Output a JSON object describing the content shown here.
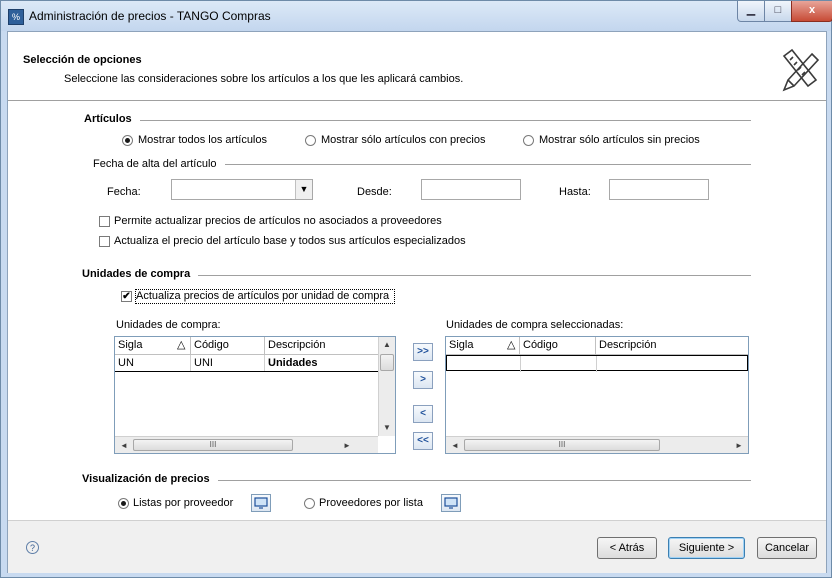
{
  "window": {
    "title": "Administración de precios - TANGO Compras",
    "icon": "tango-app-icon",
    "min_glyph": "▁",
    "max_glyph": "□",
    "close_glyph": "x"
  },
  "header": {
    "title": "Selección de opciones",
    "subtitle": "Seleccione las consideraciones sobre los artículos a los que les aplicará cambios.",
    "icon": "pencil-ruler-icon"
  },
  "articulos": {
    "section_title": "Artículos",
    "radio_all": "Mostrar todos los artículos",
    "radio_with_prices": "Mostrar sólo artículos con precios",
    "radio_without_prices": "Mostrar sólo artículos sin precios",
    "selected_radio": "all",
    "fecha_group_title": "Fecha de alta del artículo",
    "fecha_label": "Fecha:",
    "fecha_value": "",
    "desde_label": "Desde:",
    "desde_value": "",
    "hasta_label": "Hasta:",
    "hasta_value": "",
    "check_no_asociados": "Permite actualizar precios de artículos no asociados a proveedores",
    "check_no_asociados_checked": false,
    "check_base": "Actualiza el precio del artículo base y todos sus artículos especializados",
    "check_base_checked": false
  },
  "unidades": {
    "section_title": "Unidades de compra",
    "check_por_unidad": "Actualiza precios de artículos por unidad de compra",
    "check_por_unidad_checked": true,
    "check_mark": "✔",
    "left_grid_title": "Unidades de compra:",
    "right_grid_title": "Unidades de compra seleccionadas:",
    "columns": [
      "Sigla",
      "Código",
      "Descripción"
    ],
    "sort_glyph": "△",
    "left_rows": [
      {
        "sigla": "UN",
        "codigo": "UNI",
        "descripcion": "Unidades"
      }
    ],
    "right_rows": [],
    "btn_add_all": ">>",
    "btn_add": ">",
    "btn_remove": "<",
    "btn_remove_all": "<<",
    "scroll_thumb_grip": "III",
    "scroll_left": "◄",
    "scroll_right": "►",
    "scroll_up": "▲",
    "scroll_down": "▼"
  },
  "visualizacion": {
    "section_title": "Visualización de precios",
    "radio_listas": "Listas por proveedor",
    "radio_proveedores": "Proveedores por lista",
    "selected_radio": "listas"
  },
  "footer": {
    "help_glyph": "?",
    "back_label": "< Atrás",
    "next_label": "Siguiente >",
    "cancel_label": "Cancelar"
  },
  "colors": {
    "titlebar": "#c3d6ee",
    "accent": "#1d4f9a",
    "grid_border": "#7f9db9"
  }
}
